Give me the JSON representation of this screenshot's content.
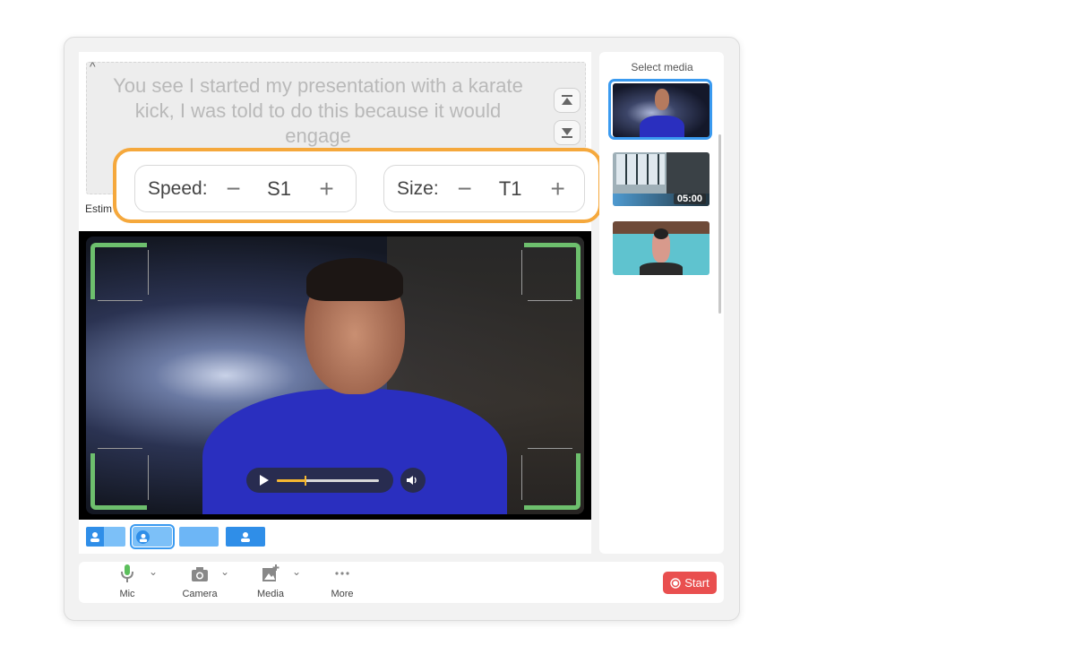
{
  "teleprompter": {
    "script_text": "You see I started my presentation with a karate kick, I was told to do this because it would engage",
    "estimate_label": "Estim"
  },
  "controls": {
    "speed_label": "Speed:",
    "speed_value": "S1",
    "size_label": "Size:",
    "size_value": "T1",
    "minus_symbol": "−",
    "plus_symbol": "+"
  },
  "player": {
    "progress_percent": 28
  },
  "media": {
    "title": "Select media",
    "items": [
      {
        "name": "presenter-video",
        "selected": true
      },
      {
        "name": "window-room-video",
        "duration": "05:00",
        "selected": false
      },
      {
        "name": "kayak-video",
        "selected": false
      }
    ]
  },
  "toolbar": {
    "mic_label": "Mic",
    "camera_label": "Camera",
    "media_label": "Media",
    "more_label": "More",
    "start_label": "Start"
  },
  "colors": {
    "accent_blue": "#3a9af0",
    "highlight_orange": "#f5a83c",
    "frame_green": "#6dbf6d",
    "start_red": "#e94f4f",
    "progress_yellow": "#f5b731"
  }
}
